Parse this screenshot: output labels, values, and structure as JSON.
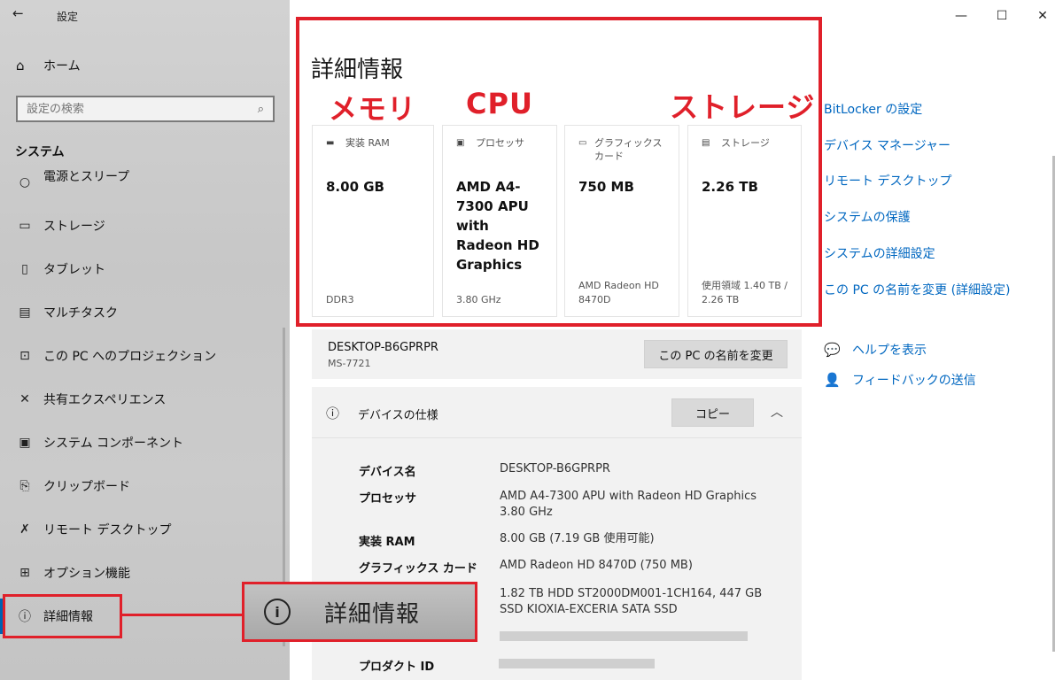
{
  "window": {
    "app_title": "設定",
    "back_label": "←",
    "minimize": "—",
    "maximize": "☐",
    "close": "✕"
  },
  "sidebar": {
    "home_label": "ホーム",
    "search_placeholder": "設定の検索",
    "section_title": "システム",
    "items": [
      {
        "label": "電源とスリープ",
        "icon": "power-icon"
      },
      {
        "label": "ストレージ",
        "icon": "storage-icon"
      },
      {
        "label": "タブレット",
        "icon": "tablet-icon"
      },
      {
        "label": "マルチタスク",
        "icon": "multitask-icon"
      },
      {
        "label": "この PC へのプロジェクション",
        "icon": "projection-icon"
      },
      {
        "label": "共有エクスペリエンス",
        "icon": "shared-experience-icon"
      },
      {
        "label": "システム コンポーネント",
        "icon": "system-components-icon"
      },
      {
        "label": "クリップボード",
        "icon": "clipboard-icon"
      },
      {
        "label": "リモート デスクトップ",
        "icon": "remote-desktop-icon"
      },
      {
        "label": "オプション機能",
        "icon": "optional-features-icon"
      },
      {
        "label": "詳細情報",
        "icon": "info-icon"
      }
    ]
  },
  "main": {
    "title": "詳細情報",
    "annotations": {
      "memory": "メモリ",
      "cpu": "CPU",
      "storage": "ストレージ",
      "callout": "詳細情報"
    },
    "cards": [
      {
        "header": "実装 RAM",
        "value": "8.00 GB",
        "sub": "DDR3",
        "icon": "ram-icon"
      },
      {
        "header": "プロセッサ",
        "value": "AMD A4-7300 APU with Radeon HD Graphics",
        "sub": "3.80 GHz",
        "icon": "cpu-icon"
      },
      {
        "header": "グラフィックス カード",
        "value": "750 MB",
        "sub": "AMD Radeon HD 8470D",
        "icon": "gpu-icon"
      },
      {
        "header": "ストレージ",
        "value": "2.26 TB",
        "sub": "使用領域 1.40 TB / 2.26 TB",
        "icon": "storage-icon"
      }
    ],
    "pc": {
      "name": "DESKTOP-B6GPRPR",
      "model": "MS-7721",
      "rename_button": "この PC の名前を変更"
    },
    "spec": {
      "title": "デバイスの仕様",
      "copy_button": "コピー",
      "rows": [
        {
          "key": "デバイス名",
          "value": "DESKTOP-B6GPRPR"
        },
        {
          "key": "プロセッサ",
          "value": "AMD A4-7300 APU with Radeon HD Graphics 3.80 GHz"
        },
        {
          "key": "実装 RAM",
          "value": "8.00 GB (7.19 GB 使用可能)"
        },
        {
          "key": "グラフィックス カード",
          "value": "AMD Radeon HD 8470D (750 MB)"
        },
        {
          "key": "",
          "value": "1.82 TB HDD ST2000DM001-1CH164, 447 GB SSD KIOXIA-EXCERIA SATA SSD"
        },
        {
          "key": "プロダクト ID",
          "value": ""
        }
      ]
    }
  },
  "related": {
    "links": [
      "BitLocker の設定",
      "デバイス マネージャー",
      "リモート デスクトップ",
      "システムの保護",
      "システムの詳細設定",
      "この PC の名前を変更 (詳細設定)"
    ],
    "help_label": "ヘルプを表示",
    "feedback_label": "フィードバックの送信"
  },
  "colors": {
    "accent": "#0067c0",
    "highlight_red": "#e0202a",
    "sidebar_bg": "#cbcbcb",
    "panel_bg": "#f2f2f2"
  }
}
